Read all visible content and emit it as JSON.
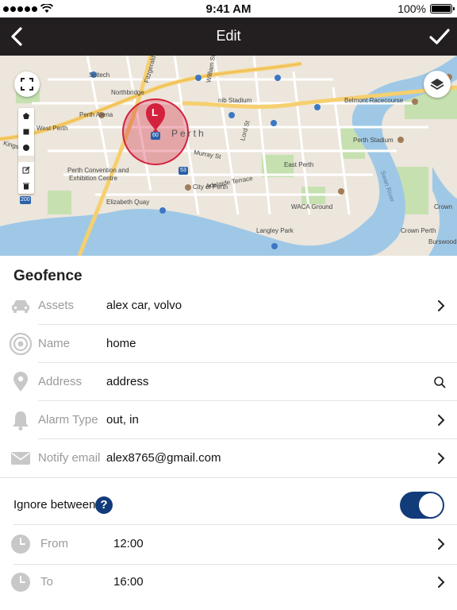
{
  "status_bar": {
    "time": "9:41 AM",
    "battery": "100%"
  },
  "nav": {
    "title": "Edit",
    "back_icon": "chevron-left-icon",
    "done_icon": "checkmark-icon"
  },
  "map": {
    "labels": {
      "scitech": "Scitech",
      "northbridge": "Northbridge",
      "fitzgerald": "Fitzgerald St",
      "william": "William St",
      "nib": "nib Stadium",
      "belmont": "Belmont Racecourse",
      "perth_arena": "Perth Arena",
      "west_perth": "West Perth",
      "kings": "Kings",
      "perth": "Perth",
      "lord_st": "Lord St",
      "perth_stadium": "Perth Stadium",
      "east_perth": "East Perth",
      "convention": "Perth Convention and",
      "convention2": "Exhibition Centre",
      "murray": "Murray St",
      "city_of_perth": "City of Perth",
      "elizabeth_quay": "Elizabeth Quay",
      "adelaide": "Adelaide Terrace",
      "waca": "WACA Ground",
      "langley": "Langley Park",
      "swan": "Swan River",
      "crown": "Crown",
      "crown_perth": "Crown Perth",
      "burswood": "Burswood",
      "pin_letter": "L",
      "route_60": "60",
      "route_53": "53",
      "route_200": "200"
    },
    "colors": {
      "water": "#9fc8e6",
      "land": "#ece6dc",
      "park": "#c6e0b0",
      "road": "#ffffff",
      "highway": "#f6cf6f",
      "geofence": "#d4213d"
    }
  },
  "form": {
    "section_title": "Geofence",
    "rows": [
      {
        "icon": "car-icon",
        "label": "Assets",
        "value": "alex car, volvo",
        "action_icon": "chevron-right-icon"
      },
      {
        "icon": "signal-icon",
        "label": "Name",
        "value": "home",
        "action_icon": ""
      },
      {
        "icon": "location-pin-icon",
        "label": "Address",
        "value": "address",
        "action_icon": "search-icon"
      },
      {
        "icon": "bell-icon",
        "label": "Alarm Type",
        "value": "out, in",
        "action_icon": "chevron-right-icon"
      },
      {
        "icon": "envelope-icon",
        "label": "Notify email",
        "value": "alex8765@gmail.com",
        "action_icon": "chevron-right-icon"
      }
    ],
    "ignore": {
      "label": "Ignore between",
      "help": "?",
      "enabled": true,
      "times": [
        {
          "icon": "clock-icon",
          "label": "From",
          "value": "12:00",
          "action_icon": "chevron-right-icon"
        },
        {
          "icon": "clock-icon",
          "label": "To",
          "value": "16:00",
          "action_icon": "chevron-right-icon"
        }
      ]
    }
  }
}
